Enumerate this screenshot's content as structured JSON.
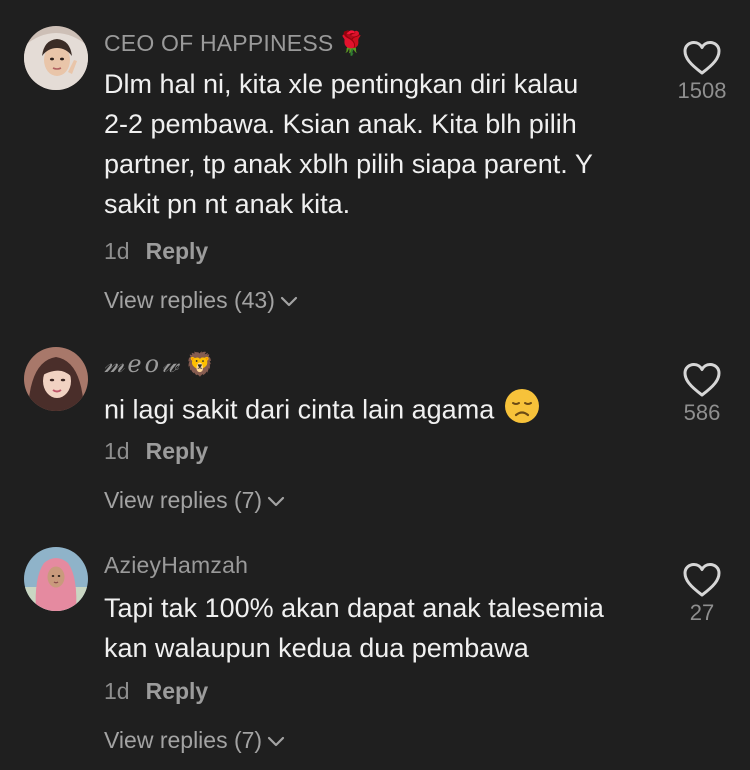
{
  "comments": [
    {
      "username": "CEO OF HAPPINESS",
      "username_emoji": "🌹",
      "text_lines": [
        "Dlm hal ni, kita xle pentingkan diri kalau",
        "2-2 pembawa. Ksian anak. Kita blh pilih",
        "partner, tp anak xblh pilih siapa parent. Y",
        "sakit pn nt anak kita."
      ],
      "time": "1d",
      "reply_label": "Reply",
      "view_replies": "View replies (43)",
      "likes": "1508",
      "avatar_icon": "avatar-girl-veil"
    },
    {
      "username": "𝓂𝑒𝑜𝓌",
      "username_emoji": "🦁",
      "text_lines": [
        "ni lagi sakit dari cinta lain agama"
      ],
      "text_emoji": "disappointed-face",
      "time": "1d",
      "reply_label": "Reply",
      "view_replies": "View replies (7)",
      "likes": "586",
      "avatar_icon": "avatar-girl-longhair"
    },
    {
      "username": "AzieyHamzah",
      "username_emoji": "",
      "text_lines": [
        "Tapi tak 100% akan dapat anak talesemia",
        "kan walaupun kedua dua pembawa"
      ],
      "time": "1d",
      "reply_label": "Reply",
      "view_replies": "View replies (7)",
      "likes": "27",
      "avatar_icon": "avatar-pink-hijab"
    }
  ],
  "colors": {
    "background": "#1f1f1f",
    "text": "#f0f0f0",
    "muted": "#8e8e8e",
    "heart_outline": "#d6d6d6"
  }
}
